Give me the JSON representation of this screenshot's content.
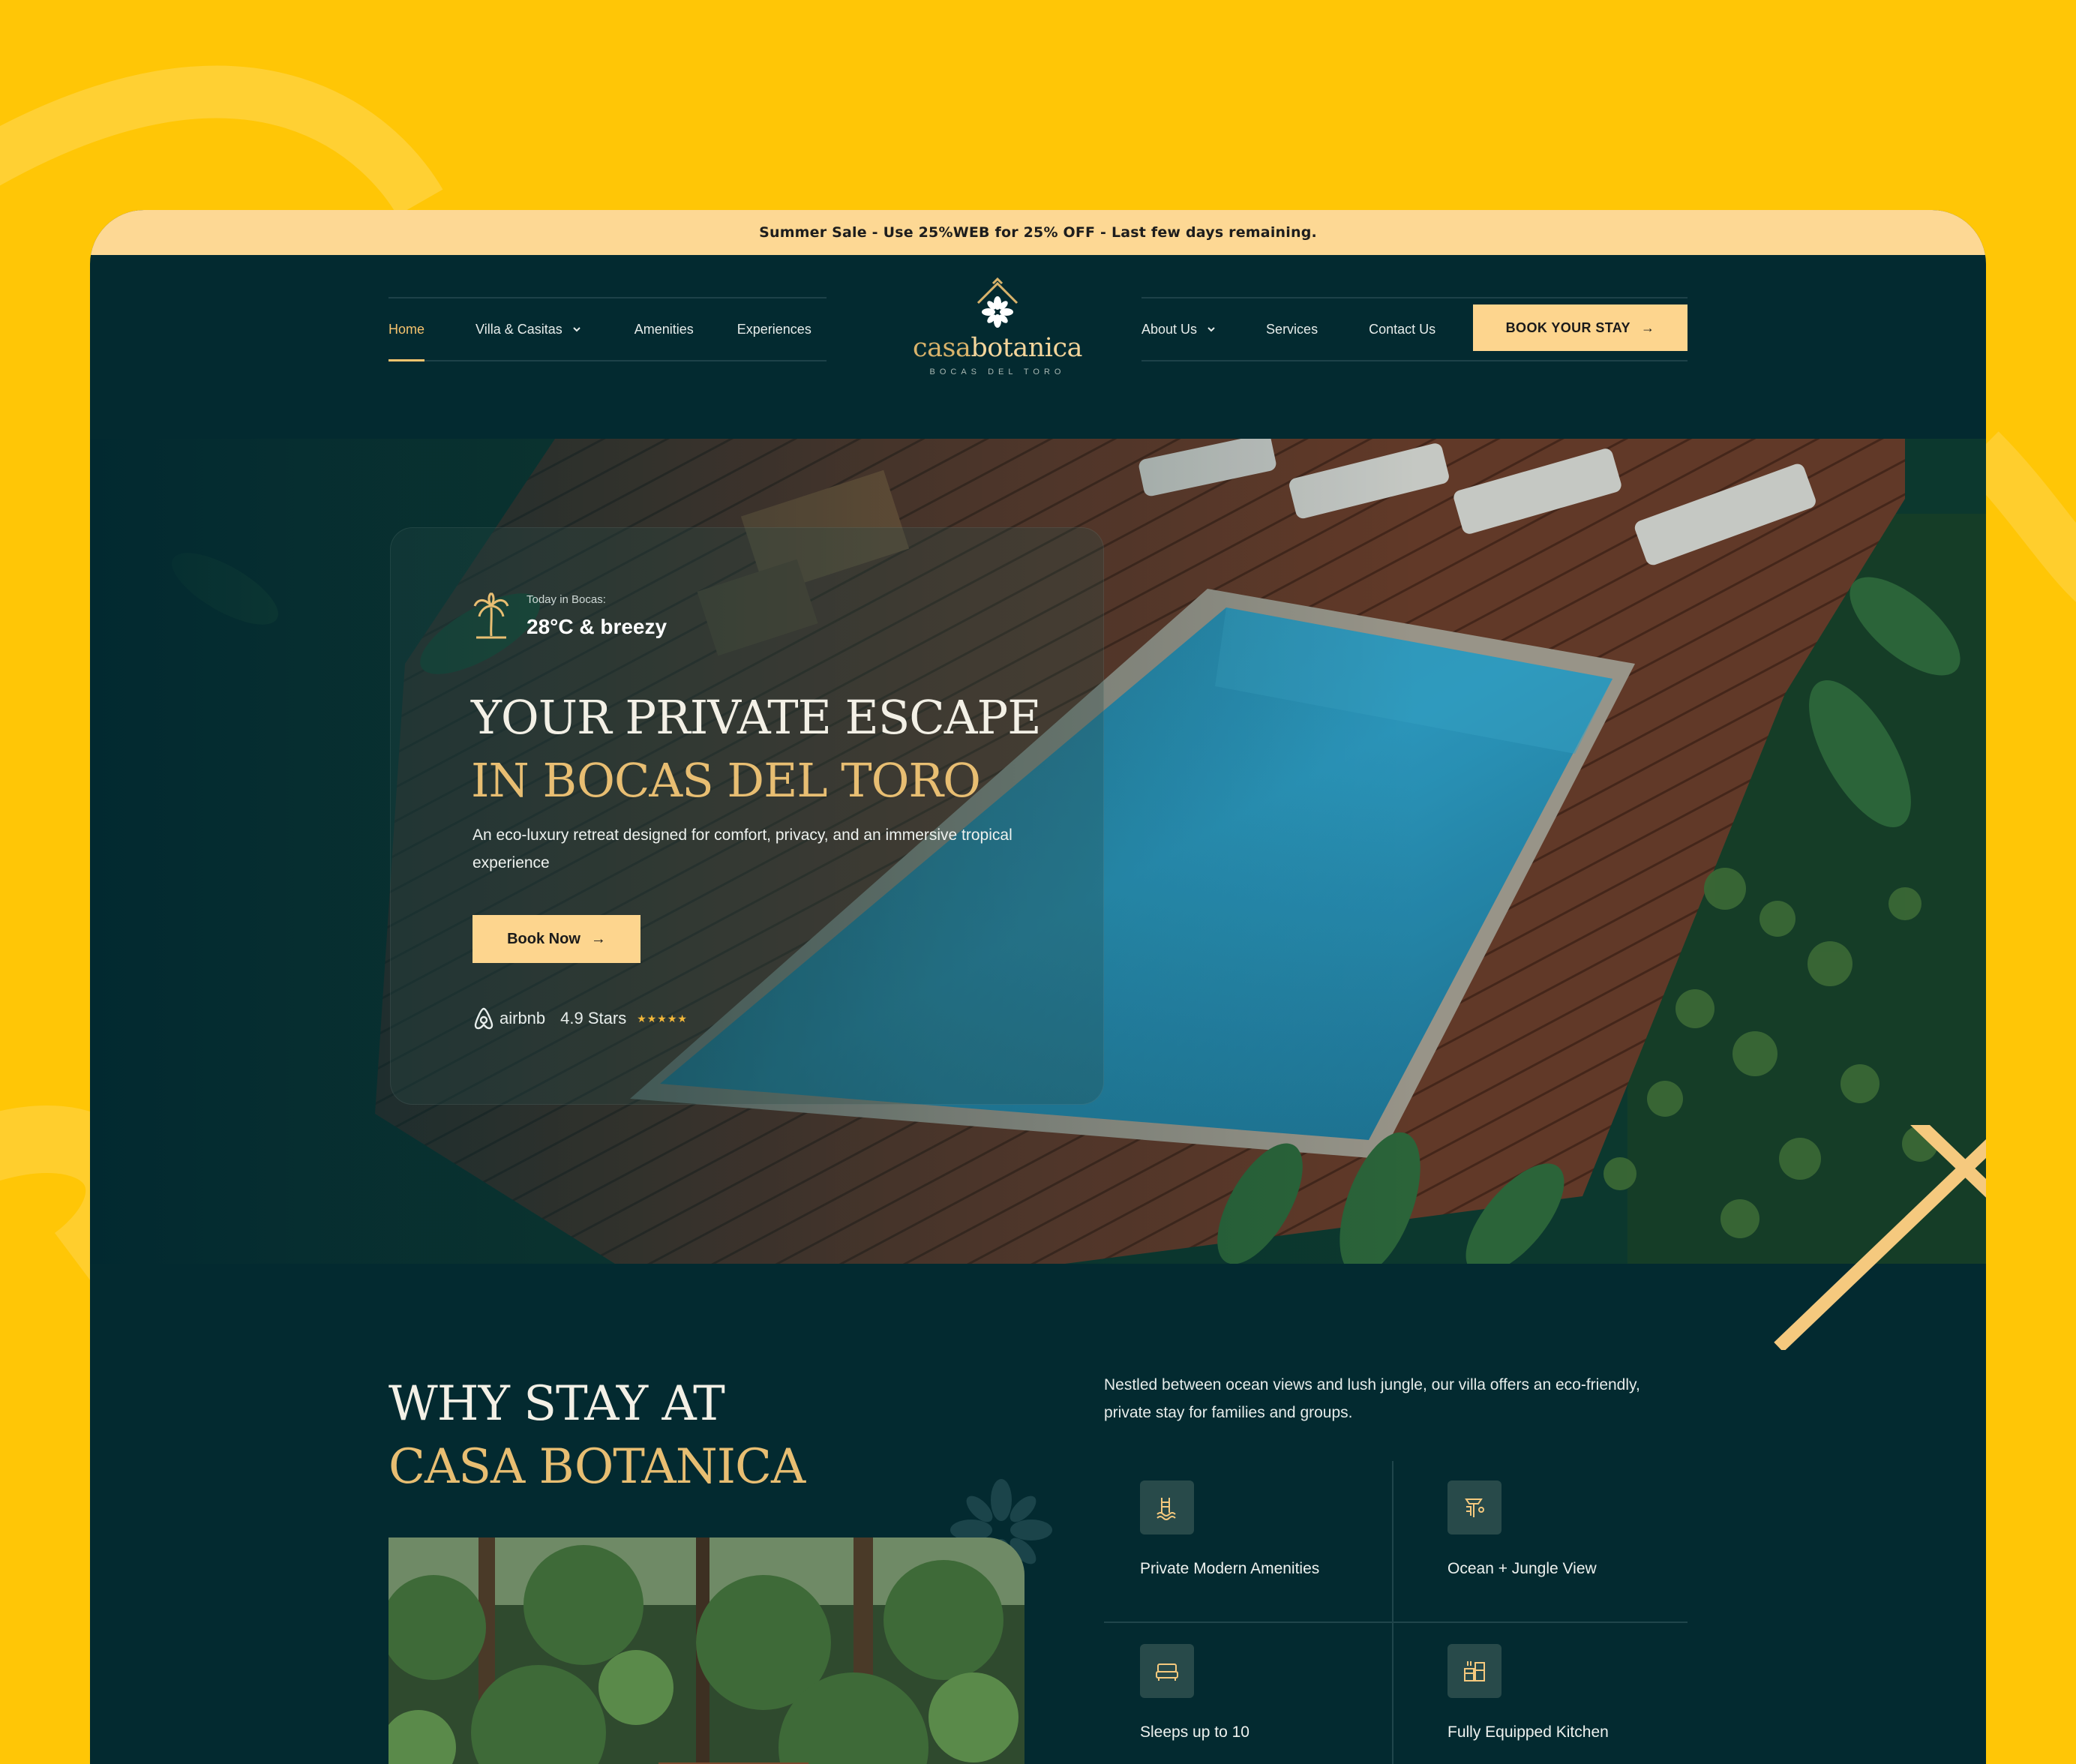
{
  "promo": {
    "text": "Summer Sale - Use 25%WEB for 25% OFF - Last few days remaining."
  },
  "nav": {
    "left_items": [
      {
        "label": "Home",
        "active": true,
        "dropdown": false
      },
      {
        "label": "Villa & Casitas",
        "active": false,
        "dropdown": true
      },
      {
        "label": "Amenities",
        "active": false,
        "dropdown": false
      },
      {
        "label": "Experiences",
        "active": false,
        "dropdown": false
      }
    ],
    "right_items": [
      {
        "label": "About Us",
        "dropdown": true
      },
      {
        "label": "Services",
        "dropdown": false
      },
      {
        "label": "Contact Us",
        "dropdown": false
      }
    ],
    "book_label": "BOOK YOUR STAY",
    "arrow": "→"
  },
  "logo": {
    "word_a": "casa",
    "word_b": "botanica",
    "sub": "BOCAS DEL TORO",
    "icon": "house-flower-icon"
  },
  "hero": {
    "weather_label": "Today in Bocas:",
    "weather_value": "28°C & breezy",
    "weather_icon": "palm-tree-icon",
    "title_line1": "YOUR PRIVATE ESCAPE",
    "title_line2": "IN BOCAS DEL TORO",
    "description": "An eco-luxury retreat designed for comfort, privacy, and an immersive tropical experience",
    "cta_label": "Book Now",
    "cta_arrow": "→",
    "rating_brand": "airbnb",
    "rating_text": "4.9 Stars",
    "rating_stars": "★★★★★"
  },
  "why": {
    "title_line1": "WHY STAY AT",
    "title_line2": "CASA BOTANICA",
    "description": "Nestled between ocean views and lush jungle, our villa offers an eco-friendly, private stay for families and groups.",
    "features": [
      {
        "label": "Private Modern Amenities",
        "icon": "pool-icon"
      },
      {
        "label": "Ocean + Jungle View",
        "icon": "beach-view-icon"
      },
      {
        "label": "Sleeps up to 10",
        "icon": "bed-icon"
      },
      {
        "label": "Fully Equipped Kitchen",
        "icon": "kitchen-icon"
      }
    ]
  },
  "colors": {
    "background": "#FFC606",
    "page_dark": "#032A30",
    "promo_bar": "#FDD894",
    "accent_gold": "#E8BE72",
    "button": "#FDD58E"
  }
}
